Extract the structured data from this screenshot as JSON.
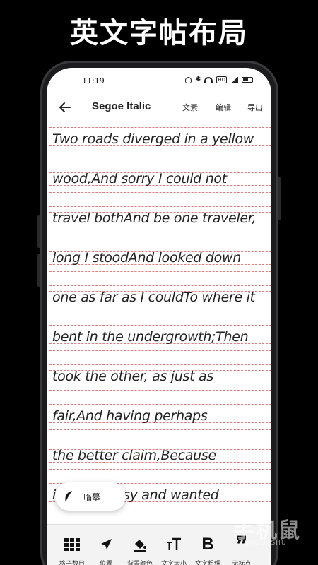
{
  "promo": {
    "title": "英文字帖布局"
  },
  "status_bar": {
    "time": "11:19"
  },
  "app_bar": {
    "title": "Segoe Italic",
    "actions": [
      "文素",
      "编辑",
      "导出"
    ]
  },
  "paper": {
    "lines": [
      "Two roads diverged in a yellow",
      "wood,And sorry I could not",
      "travel bothAnd be one traveler,",
      "long I stoodAnd looked down",
      "one as far as I couldTo where it",
      "bent in the undergrowth;Then",
      "took the other, as just as",
      "fair,And having perhaps",
      "the better claim,Because",
      "it was grassy and wanted"
    ]
  },
  "trace_button": {
    "label": "临摹"
  },
  "toolbar": {
    "items": [
      {
        "icon": "grid-icon",
        "label": "格子数目"
      },
      {
        "icon": "location-arrow-icon",
        "label": "位置"
      },
      {
        "icon": "paint-bucket-icon",
        "label": "背景颜色"
      },
      {
        "icon": "text-size-icon",
        "label": "文字大小"
      },
      {
        "icon": "bold-icon",
        "label": "文字粗细"
      },
      {
        "icon": "quote-icon",
        "label": "无标点"
      }
    ]
  },
  "watermark": {
    "text": "手机鼠",
    "sub": "SHOUJISHU"
  }
}
